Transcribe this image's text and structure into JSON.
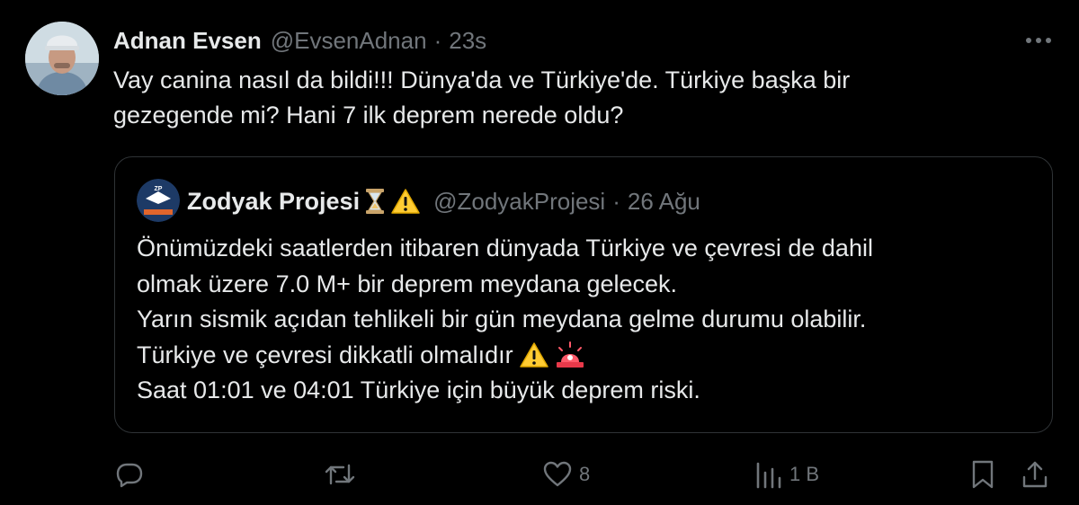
{
  "tweet": {
    "author_name": "Adnan Evsen",
    "handle": "@EvsenAdnan",
    "separator": "·",
    "time": "23s",
    "text_lines": [
      "Vay canina nasıl da bildi!!! Dünya'da ve Türkiye'de. Türkiye başka bir",
      "gezegende mi? Hani 7 ilk deprem nerede oldu?"
    ],
    "more_icon": "ellipsis-icon"
  },
  "quote": {
    "author_name": "Zodyak Projesi",
    "name_emojis": [
      "hourglass-emoji",
      "warning-emoji"
    ],
    "handle": "@ZodyakProjesi",
    "separator": "·",
    "time": "26 Ağu",
    "avatar_text": "ZP",
    "text_lines": [
      "Önümüzdeki saatlerden itibaren dünyada Türkiye ve çevresi de dahil",
      "olmak üzere 7.0 M+ bir deprem meydana gelecek.",
      "Yarın sismik açıdan tehlikeli bir gün meydana gelme durumu olabilir.",
      "Türkiye ve çevresi dikkatli olmalıdır",
      "Saat 01:01 ve 04:01 Türkiye için büyük deprem riski."
    ],
    "line4_emojis": [
      "warning-emoji",
      "police-light-emoji"
    ]
  },
  "actions": {
    "reply": {
      "icon": "reply-icon",
      "count": ""
    },
    "retweet": {
      "icon": "retweet-icon",
      "count": ""
    },
    "like": {
      "icon": "heart-icon",
      "count": "8"
    },
    "views": {
      "icon": "views-icon",
      "count": "1 B"
    },
    "bookmark": {
      "icon": "bookmark-icon",
      "count": ""
    },
    "share": {
      "icon": "share-icon",
      "count": ""
    }
  },
  "colors": {
    "background": "#000000",
    "text_primary": "#e7e9ea",
    "text_secondary": "#71767b",
    "border": "#2f3336"
  }
}
